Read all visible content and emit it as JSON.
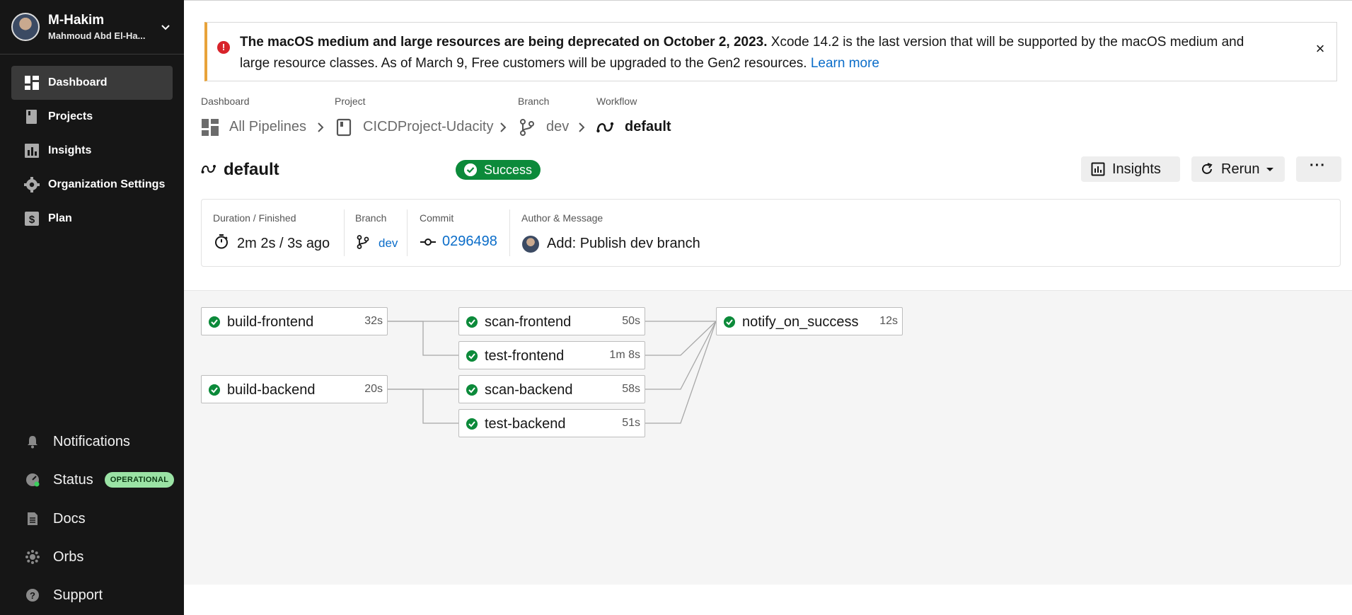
{
  "user": {
    "name": "M-Hakim",
    "full_name": "Mahmoud Abd El-Ha..."
  },
  "sidebar": {
    "items": [
      {
        "label": "Dashboard",
        "icon": "dashboard-icon",
        "active": true
      },
      {
        "label": "Projects",
        "icon": "book-icon"
      },
      {
        "label": "Insights",
        "icon": "bar-chart-icon"
      },
      {
        "label": "Organization Settings",
        "icon": "gear-icon"
      },
      {
        "label": "Plan",
        "icon": "dollar-icon"
      }
    ],
    "bottom": [
      {
        "label": "Notifications",
        "icon": "bell-icon"
      },
      {
        "label": "Status",
        "icon": "gauge-icon",
        "badge": "OPERATIONAL"
      },
      {
        "label": "Docs",
        "icon": "document-icon"
      },
      {
        "label": "Orbs",
        "icon": "orb-icon"
      },
      {
        "label": "Support",
        "icon": "help-icon"
      }
    ]
  },
  "banner": {
    "bold": "The macOS medium and large resources are being deprecated on October 2, 2023.",
    "text": " Xcode 14.2 is the last version that will be supported by the macOS medium and large resource classes. As of March 9, Free customers will be upgraded to the Gen2 resources. ",
    "link": "Learn more",
    "close": "×"
  },
  "breadcrumb": [
    {
      "label": "Dashboard",
      "value": "All Pipelines",
      "icon": "dashboard-icon"
    },
    {
      "label": "Project",
      "value": "CICDProject-Udacity",
      "icon": "book-icon"
    },
    {
      "label": "Branch",
      "value": "dev",
      "icon": "branch-icon"
    },
    {
      "label": "Workflow",
      "value": "default",
      "icon": "workflow-icon"
    }
  ],
  "workflow": {
    "name": "default",
    "status": "Success"
  },
  "actions": {
    "insights": "Insights",
    "rerun": "Rerun",
    "more": "···"
  },
  "info": {
    "duration_label": "Duration / Finished",
    "duration_value": "2m 2s / 3s ago",
    "branch_label": "Branch",
    "branch_value": "dev",
    "commit_label": "Commit",
    "commit_value": "0296498",
    "author_label": "Author & Message",
    "message": "Add: Publish dev branch"
  },
  "jobs": [
    {
      "name": "build-frontend",
      "duration": "32s"
    },
    {
      "name": "build-backend",
      "duration": "20s"
    },
    {
      "name": "scan-frontend",
      "duration": "50s"
    },
    {
      "name": "test-frontend",
      "duration": "1m 8s"
    },
    {
      "name": "scan-backend",
      "duration": "58s"
    },
    {
      "name": "test-backend",
      "duration": "51s"
    },
    {
      "name": "notify_on_success",
      "duration": "12s"
    }
  ],
  "colors": {
    "sidebar": "#161616",
    "success": "#0c8a3a",
    "link": "#0b6dc9",
    "warning": "#e8a33a",
    "error": "#d8232a"
  }
}
